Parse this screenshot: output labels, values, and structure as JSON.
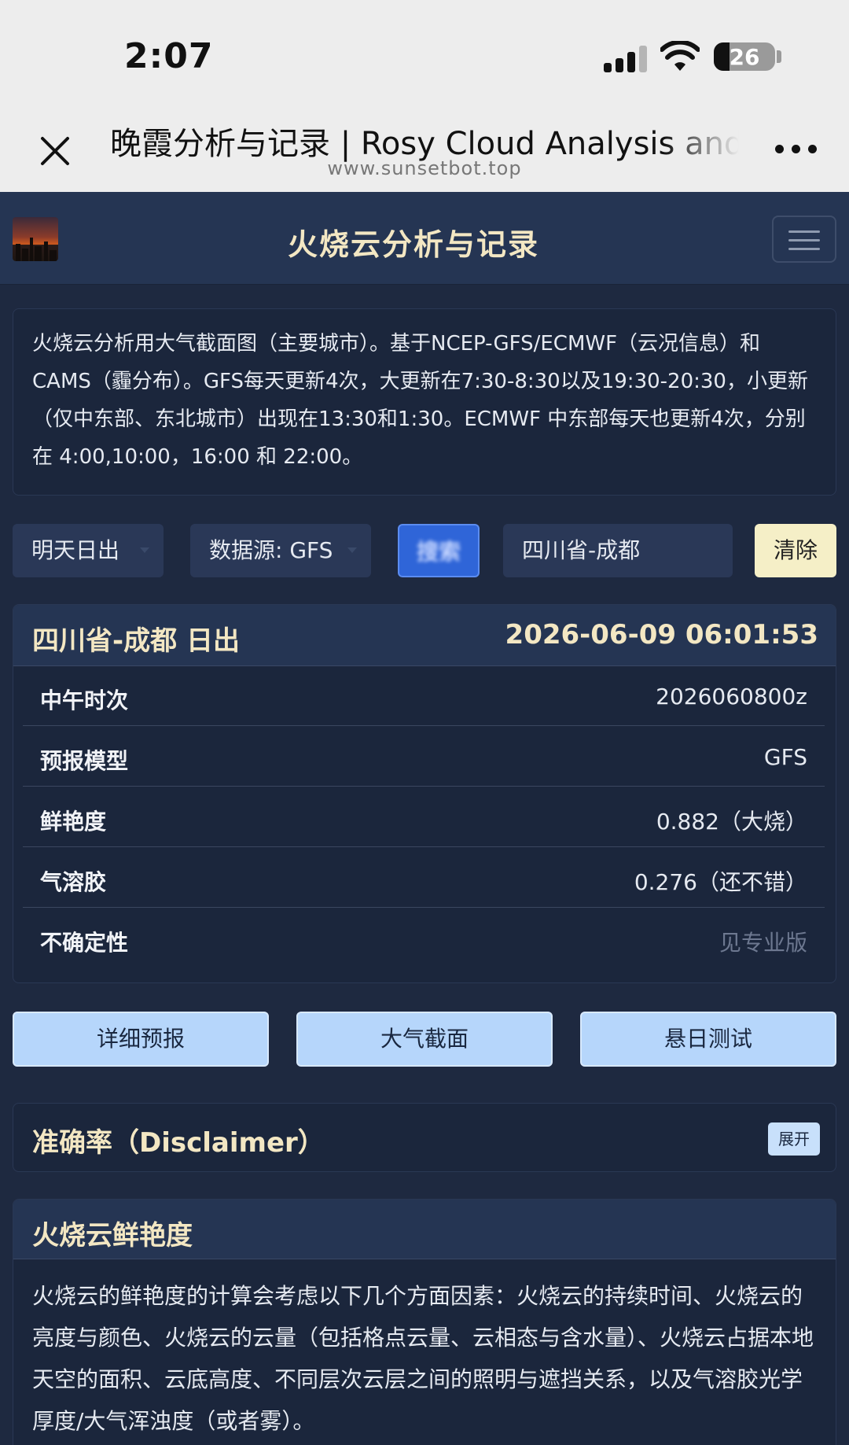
{
  "status_bar": {
    "time": "2:07",
    "battery": "26",
    "battery_level": 0.26
  },
  "browser": {
    "title": "晚霞分析与记录 | Rosy Cloud Analysis and",
    "url": "www.sunsetbot.top"
  },
  "navbar": {
    "title": "火烧云分析与记录"
  },
  "intro": {
    "text": "火烧云分析用大气截面图（主要城市）。基于NCEP-GFS/ECMWF（云况信息）和CAMS（霾分布）。GFS每天更新4次，大更新在7:30-8:30以及19:30-20:30，小更新（仅中东部、东北城市）出现在13:30和1:30。ECMWF 中东部每天也更新4次，分别在 4:00,10:00，16:00 和 22:00。"
  },
  "controls": {
    "event_select": "明天日出",
    "source_select": "数据源: GFS",
    "query_button": "搜索",
    "city_value": "四川省-成都",
    "clear_button": "清除"
  },
  "result": {
    "location": "四川省-成都 日出",
    "datetime": "2026-06-09 06:01:53",
    "rows": [
      {
        "label": "中午时次",
        "value": "2026060800z"
      },
      {
        "label": "预报模型",
        "value": "GFS"
      },
      {
        "label": "鲜艳度",
        "value": "0.882（大烧）"
      },
      {
        "label": "气溶胶",
        "value": "0.276（还不错）"
      },
      {
        "label": "不确定性",
        "value": "见专业版"
      }
    ]
  },
  "actions": {
    "detail": "详细预报",
    "section": "大气截面",
    "sun_test": "悬日测试"
  },
  "disclaimer": {
    "title": "准确率（Disclaimer）",
    "expand_button": "展开"
  },
  "vividness": {
    "title": "火烧云鲜艳度",
    "text": "火烧云的鲜艳度的计算会考虑以下几个方面因素：火烧云的持续时间、火烧云的亮度与颜色、火烧云的云量（包括格点云量、云相态与含水量）、火烧云占据本地天空的面积、云底高度、不同层次云层之间的照明与遮挡关系，以及气溶胶光学厚度/大气浑浊度（或者雾）。"
  }
}
